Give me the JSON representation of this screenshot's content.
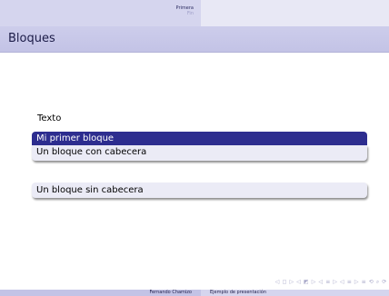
{
  "headline": {
    "sections": [
      "Primera",
      "Fin"
    ]
  },
  "frame": {
    "title": "Bloques",
    "text": "Texto",
    "blocks": [
      {
        "title": "Mi primer bloque",
        "body": "Un bloque con cabecera"
      },
      {
        "body": "Un bloque sin cabecera"
      }
    ]
  },
  "navigation": {
    "symbols": "◁ ◻ ▷ ◁ ◩ ▷ ◁ ≡ ▷ ◁ ≡ ▷ ≡ ⟲ ⌕ ⟳"
  },
  "footline": {
    "author": "Fernando Chamizo",
    "title": "Ejemplo de presentación"
  },
  "colors": {
    "block_title_bg": "#2d2d8f",
    "block_body_bg": "#ebebf6",
    "bar_bg": "#c3c3e6"
  }
}
